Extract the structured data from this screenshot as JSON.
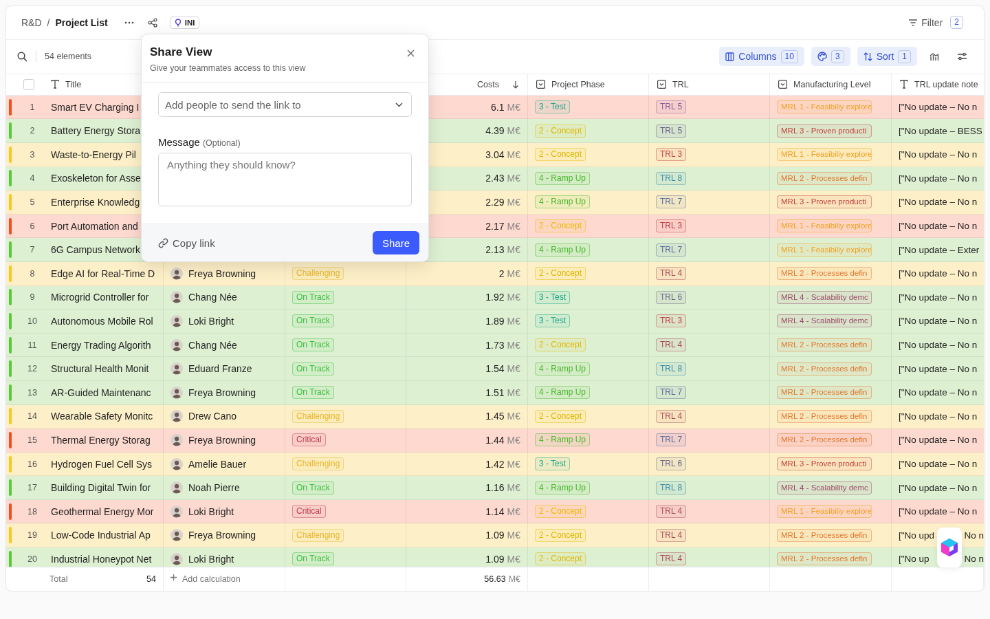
{
  "breadcrumb": {
    "parent": "R&D",
    "separator": "/",
    "current": "Project List"
  },
  "view_badge": "INI",
  "filter": {
    "label": "Filter",
    "count": "2"
  },
  "toolbar": {
    "count_label": "54 elements",
    "columns": {
      "label": "Columns",
      "count": "10"
    },
    "colors": {
      "count": "3"
    },
    "sort": {
      "label": "Sort",
      "count": "1"
    }
  },
  "table": {
    "select_all": {
      "checked": false
    },
    "columns": [
      {
        "label": "Title",
        "kind": "text"
      },
      {
        "label": "Costs",
        "kind": "sort"
      },
      {
        "label": "Project Phase",
        "kind": "select"
      },
      {
        "label": "TRL",
        "kind": "select"
      },
      {
        "label": "Manufacturing Level",
        "kind": "select"
      },
      {
        "label": "TRL update note",
        "kind": "text"
      }
    ],
    "rows": [
      {
        "num": "1",
        "kind": "critical",
        "title": "Smart EV Charging I",
        "cost": "6.1",
        "unit": "M€",
        "phase": {
          "label": "3 - Test",
          "color": "#1aa88a"
        },
        "trl": {
          "label": "TRL 5",
          "color": "#8a5a9a"
        },
        "mrl": {
          "label": "MRL 1 - Feasibiliy explore",
          "color": "#f0a020"
        },
        "note": "[\"No update – No n"
      },
      {
        "num": "2",
        "kind": "on_track",
        "title": "Battery Energy Stora",
        "cost": "4.39",
        "unit": "M€",
        "phase": {
          "label": "2 - Concept",
          "color": "#e0b800"
        },
        "trl": {
          "label": "TRL 5",
          "color": "#6a5a8a"
        },
        "mrl": {
          "label": "MRL 3 - Proven producti",
          "color": "#c04040"
        },
        "note": "[\"No update – BESS"
      },
      {
        "num": "3",
        "kind": "challenging",
        "title": "Waste-to-Energy Pil",
        "cost": "3.04",
        "unit": "M€",
        "phase": {
          "label": "2 - Concept",
          "color": "#e0b800"
        },
        "trl": {
          "label": "TRL 3",
          "color": "#c0404a"
        },
        "mrl": {
          "label": "MRL 1 - Feasibiliy explore",
          "color": "#f0a020"
        },
        "note": "[\"No update – No n"
      },
      {
        "num": "4",
        "kind": "on_track",
        "title": "Exoskeleton for Asse",
        "cost": "2.43",
        "unit": "M€",
        "phase": {
          "label": "4 - Ramp Up",
          "color": "#4cb82e"
        },
        "trl": {
          "label": "TRL 8",
          "color": "#3a8aaa"
        },
        "mrl": {
          "label": "MRL 2 - Processes defin",
          "color": "#e07830"
        },
        "note": "[\"No update – No n"
      },
      {
        "num": "5",
        "kind": "challenging",
        "title": "Enterprise Knowledg",
        "cost": "2.29",
        "unit": "M€",
        "phase": {
          "label": "4 - Ramp Up",
          "color": "#4cb82e"
        },
        "trl": {
          "label": "TRL 7",
          "color": "#5a6a9a"
        },
        "mrl": {
          "label": "MRL 3 - Proven producti",
          "color": "#c04040"
        },
        "note": "[\"No update – No n"
      },
      {
        "num": "6",
        "kind": "critical",
        "title": "Port Automation and",
        "cost": "2.17",
        "unit": "M€",
        "phase": {
          "label": "2 - Concept",
          "color": "#f0b800"
        },
        "trl": {
          "label": "TRL 3",
          "color": "#c0404a"
        },
        "mrl": {
          "label": "MRL 1 - Feasibiliy explore",
          "color": "#f0a020"
        },
        "note": "[\"No update – No n"
      },
      {
        "num": "7",
        "kind": "on_track",
        "title": "6G Campus Network",
        "cost": "2.13",
        "unit": "M€",
        "phase": {
          "label": "4 - Ramp Up",
          "color": "#4cb82e"
        },
        "trl": {
          "label": "TRL 7",
          "color": "#5a6a9a"
        },
        "mrl": {
          "label": "MRL 1 - Feasibiliy explore",
          "color": "#f0a020"
        },
        "note": "[\"No update – Exter"
      },
      {
        "num": "8",
        "kind": "challenging",
        "title": "Edge AI for Real-Time D",
        "owner": "Freya Browning",
        "status": {
          "label": "Challenging",
          "color": "#e8b830"
        },
        "cost": "2",
        "unit": "M€",
        "phase": {
          "label": "2 - Concept",
          "color": "#e0b800"
        },
        "trl": {
          "label": "TRL 4",
          "color": "#a84a5a"
        },
        "mrl": {
          "label": "MRL 2 - Processes defin",
          "color": "#e07830"
        },
        "note": "[\"No update – No n"
      },
      {
        "num": "9",
        "kind": "on_track",
        "title": "Microgrid Controller for",
        "owner": "Chang Née",
        "status": {
          "label": "On Track",
          "color": "#3cc040"
        },
        "cost": "1.92",
        "unit": "M€",
        "phase": {
          "label": "3 - Test",
          "color": "#1aa88a"
        },
        "trl": {
          "label": "TRL 6",
          "color": "#6a6a8a"
        },
        "mrl": {
          "label": "MRL 4 - Scalability demc",
          "color": "#9a4a6a"
        },
        "note": "[\"No update – No n"
      },
      {
        "num": "10",
        "kind": "on_track",
        "title": "Autonomous Mobile Rol",
        "owner": "Loki Bright",
        "status": {
          "label": "On Track",
          "color": "#3cc040"
        },
        "cost": "1.89",
        "unit": "M€",
        "phase": {
          "label": "3 - Test",
          "color": "#1aa88a"
        },
        "trl": {
          "label": "TRL 3",
          "color": "#c0404a"
        },
        "mrl": {
          "label": "MRL 4 - Scalability demc",
          "color": "#9a4a6a"
        },
        "note": "[\"No update – No n"
      },
      {
        "num": "11",
        "kind": "on_track",
        "title": "Energy Trading Algorith",
        "owner": "Chang Née",
        "status": {
          "label": "On Track",
          "color": "#3cc040"
        },
        "cost": "1.73",
        "unit": "M€",
        "phase": {
          "label": "2 - Concept",
          "color": "#e0b800"
        },
        "trl": {
          "label": "TRL 4",
          "color": "#a84a5a"
        },
        "mrl": {
          "label": "MRL 2 - Processes defin",
          "color": "#e07830"
        },
        "note": "[\"No update – No n"
      },
      {
        "num": "12",
        "kind": "on_track",
        "title": "Structural Health Monit",
        "owner": "Eduard Franze",
        "status": {
          "label": "On Track",
          "color": "#3cc040"
        },
        "cost": "1.54",
        "unit": "M€",
        "phase": {
          "label": "4 - Ramp Up",
          "color": "#4cb82e"
        },
        "trl": {
          "label": "TRL 8",
          "color": "#3a8aaa"
        },
        "mrl": {
          "label": "MRL 2 - Processes defin",
          "color": "#e07830"
        },
        "note": "[\"No update – No n"
      },
      {
        "num": "13",
        "kind": "on_track",
        "title": "AR-Guided Maintenanc",
        "owner": "Freya Browning",
        "status": {
          "label": "On Track",
          "color": "#3cc040"
        },
        "cost": "1.51",
        "unit": "M€",
        "phase": {
          "label": "4 - Ramp Up",
          "color": "#4cb82e"
        },
        "trl": {
          "label": "TRL 7",
          "color": "#5a6a9a"
        },
        "mrl": {
          "label": "MRL 2 - Processes defin",
          "color": "#e07830"
        },
        "note": "[\"No update – No n"
      },
      {
        "num": "14",
        "kind": "challenging",
        "title": "Wearable Safety Monitc",
        "owner": "Drew Cano",
        "status": {
          "label": "Challenging",
          "color": "#e8b830"
        },
        "cost": "1.45",
        "unit": "M€",
        "phase": {
          "label": "2 - Concept",
          "color": "#e0b800"
        },
        "trl": {
          "label": "TRL 4",
          "color": "#a84a5a"
        },
        "mrl": {
          "label": "MRL 2 - Processes defin",
          "color": "#e07830"
        },
        "note": "[\"No update – No n"
      },
      {
        "num": "15",
        "kind": "critical",
        "title": "Thermal Energy Storag",
        "owner": "Freya Browning",
        "status": {
          "label": "Critical",
          "color": "#c04050"
        },
        "cost": "1.44",
        "unit": "M€",
        "phase": {
          "label": "4 - Ramp Up",
          "color": "#4cb82e"
        },
        "trl": {
          "label": "TRL 7",
          "color": "#5a6a9a"
        },
        "mrl": {
          "label": "MRL 2 - Processes defin",
          "color": "#e07830"
        },
        "note": "[\"No update – No n"
      },
      {
        "num": "16",
        "kind": "challenging",
        "title": "Hydrogen Fuel Cell Sys",
        "owner": "Amelie Bauer",
        "status": {
          "label": "Challenging",
          "color": "#e8b830"
        },
        "cost": "1.42",
        "unit": "M€",
        "phase": {
          "label": "3 - Test",
          "color": "#1aa88a"
        },
        "trl": {
          "label": "TRL 6",
          "color": "#6a6a8a"
        },
        "mrl": {
          "label": "MRL 3 - Proven producti",
          "color": "#c04040"
        },
        "note": "[\"No update – No n"
      },
      {
        "num": "17",
        "kind": "on_track",
        "title": "Building Digital Twin for",
        "owner": "Noah Pierre",
        "status": {
          "label": "On Track",
          "color": "#3cc040"
        },
        "cost": "1.16",
        "unit": "M€",
        "phase": {
          "label": "4 - Ramp Up",
          "color": "#4cb82e"
        },
        "trl": {
          "label": "TRL 8",
          "color": "#3a8aaa"
        },
        "mrl": {
          "label": "MRL 4 - Scalability demc",
          "color": "#9a4a6a"
        },
        "note": "[\"No update – No n"
      },
      {
        "num": "18",
        "kind": "critical",
        "title": "Geothermal Energy Mor",
        "owner": "Loki Bright",
        "status": {
          "label": "Critical",
          "color": "#c04050"
        },
        "cost": "1.14",
        "unit": "M€",
        "phase": {
          "label": "2 - Concept",
          "color": "#f0b800"
        },
        "trl": {
          "label": "TRL 4",
          "color": "#a84a5a"
        },
        "mrl": {
          "label": "MRL 1 - Feasibiliy explore",
          "color": "#f0a020"
        },
        "note": "[\"No update – No n"
      },
      {
        "num": "19",
        "kind": "challenging",
        "title": "Low-Code Industrial Ap",
        "owner": "Freya Browning",
        "status": {
          "label": "Challenging",
          "color": "#e8b830"
        },
        "cost": "1.09",
        "unit": "M€",
        "phase": {
          "label": "2 - Concept",
          "color": "#e0b800"
        },
        "trl": {
          "label": "TRL 4",
          "color": "#a84a5a"
        },
        "mrl": {
          "label": "MRL 2 - Processes defin",
          "color": "#e07830"
        },
        "note": "[\"No upd",
        "note_tail": "No n"
      },
      {
        "num": "20",
        "kind": "on_track",
        "title": "Industrial Honeypot Net",
        "owner": "Loki Bright",
        "status": {
          "label": "On Track",
          "color": "#3cc040"
        },
        "cost": "1.09",
        "unit": "M€",
        "phase": {
          "label": "2 - Concept",
          "color": "#e0b800"
        },
        "trl": {
          "label": "TRL 4",
          "color": "#a84a5a"
        },
        "mrl": {
          "label": "MRL 2 - Processes defin",
          "color": "#e07830"
        },
        "note": "[\"No up",
        "note_tail": "No n"
      }
    ],
    "footer": {
      "label": "Total",
      "count": "54",
      "add": "Add calculation",
      "sum": "56.63",
      "unit": "M€"
    }
  },
  "share_dialog": {
    "title": "Share View",
    "subtitle": "Give your teammates access to this view",
    "people": {
      "placeholder": "Add people to send the link to"
    },
    "message_label": "Message",
    "message_hint": "(Optional)",
    "message": {
      "placeholder": "Anything they should know?"
    },
    "copy_link": "Copy link",
    "share": "Share"
  }
}
